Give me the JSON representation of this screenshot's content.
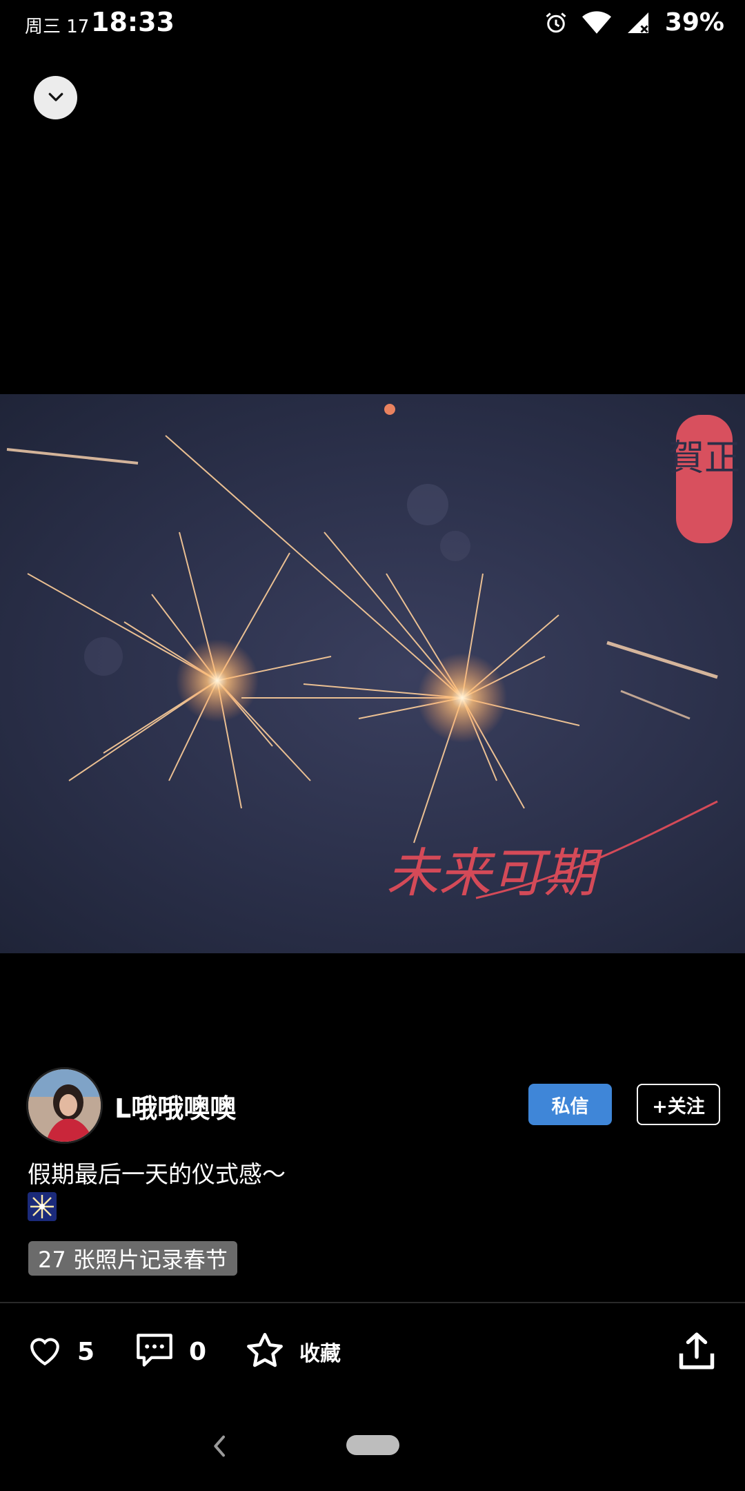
{
  "status_bar": {
    "date": "周三 17",
    "time": "18:33",
    "battery": "39%",
    "icons": [
      "alarm-icon",
      "wifi-icon",
      "signal-icon"
    ]
  },
  "photo": {
    "description_icons": [
      "sparkler-photo"
    ],
    "seal_text": "賀正",
    "handwriting": "未来可期"
  },
  "author": {
    "name": "L哦哦噢噢",
    "dm_label": "私信",
    "follow_label": "+关注"
  },
  "post": {
    "caption": "假期最后一天的仪式感～",
    "emoji_icon": "sparkler-emoji",
    "album_tag": "27 张照片记录春节"
  },
  "actions": {
    "likes": "5",
    "comments": "0",
    "favorite_label": "收藏",
    "share_icon": "share-icon"
  },
  "colors": {
    "accent": "#3f86d8",
    "background": "#000000",
    "tag_bg": "#6b6b6b",
    "seal": "#d8505e"
  }
}
